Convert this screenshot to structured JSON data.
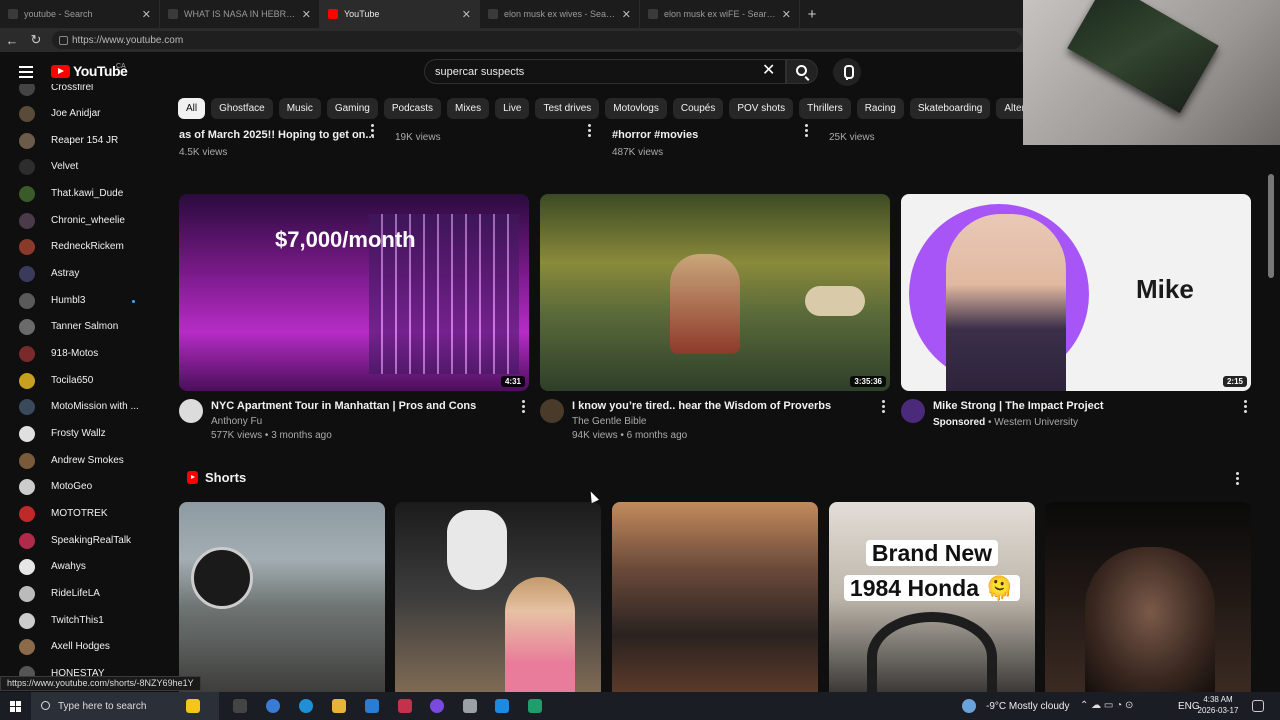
{
  "browser": {
    "tabs": [
      {
        "label": "youtube - Search",
        "active": false
      },
      {
        "label": "WHAT IS NASA IN HEBREW - Search",
        "active": false
      },
      {
        "label": "YouTube",
        "active": true
      },
      {
        "label": "elon musk ex wives - Search",
        "active": false
      },
      {
        "label": "elon musk ex wiFE - Search Images",
        "active": false
      }
    ],
    "new_tab": "+",
    "url": "https://www.youtube.com"
  },
  "youtube": {
    "logo_text": "YouTube",
    "country_code": "CA",
    "search_value": "supercar suspects"
  },
  "sidebar": {
    "partial_top": "Crossfirel",
    "subscriptions": [
      {
        "name": "Joe Anidjar",
        "color": "#5a4a3a"
      },
      {
        "name": "Reaper 154 JR",
        "color": "#6b5b4b"
      },
      {
        "name": "Velvet",
        "color": "#2d2d2d"
      },
      {
        "name": "That.kawi_Dude",
        "color": "#3a5a2a"
      },
      {
        "name": "Chronic_wheelie",
        "color": "#4a3a4a"
      },
      {
        "name": "RedneckRickem",
        "color": "#8a3a2a"
      },
      {
        "name": "Astray",
        "color": "#3a3a5a"
      },
      {
        "name": "Humbl3",
        "color": "#5a5a5a",
        "new": true
      },
      {
        "name": "Tanner Salmon",
        "color": "#6a6a6a"
      },
      {
        "name": "918-Motos",
        "color": "#7a2a2a"
      },
      {
        "name": "Tocila650",
        "color": "#c7a020"
      },
      {
        "name": "MotoMission with ...",
        "color": "#3a4a5a"
      },
      {
        "name": "Frosty Wallz",
        "color": "#e0e0e0"
      },
      {
        "name": "Andrew Smokes",
        "color": "#7a5a3a"
      },
      {
        "name": "MotoGeo",
        "color": "#cccccc"
      },
      {
        "name": "MOTOTREK",
        "color": "#c0282a"
      },
      {
        "name": "SpeakingRealTalk",
        "color": "#b02a4a"
      },
      {
        "name": "Awahys",
        "color": "#e6e6e6"
      },
      {
        "name": "RideLifeLA",
        "color": "#bbbbbb"
      },
      {
        "name": "TwitchThis1",
        "color": "#cccccc"
      },
      {
        "name": "Axell Hodges",
        "color": "#8a6a4a"
      }
    ],
    "partial_bottom": "HONESTAY"
  },
  "chips": [
    "All",
    "Ghostface",
    "Music",
    "Gaming",
    "Podcasts",
    "Mixes",
    "Live",
    "Test drives",
    "Motovlogs",
    "Coupés",
    "POV shots",
    "Thrillers",
    "Racing",
    "Skateboarding",
    "Alter"
  ],
  "above_row": {
    "v1_title": "as of March 2025!! Hoping to get on...",
    "v1_views": "4.5K views",
    "v2_views": "19K views",
    "v3_title": "#horror #movies",
    "v3_views": "487K views",
    "v4_views": "25K views"
  },
  "videos": [
    {
      "title": "NYC Apartment Tour in Manhattan | Pros and Cons",
      "channel": "Anthony Fu",
      "meta": "577K views • 3 months ago",
      "duration": "4:31",
      "overlay": "$7,000/month"
    },
    {
      "title": "I know you’re tired.. hear the Wisdom of Proverbs",
      "channel": "The Gentle Bible",
      "meta": "94K views • 6 months ago",
      "duration": "3:35:36"
    },
    {
      "title": "Mike Strong | The Impact Project",
      "sponsored": "Sponsored",
      "channel": "• Western University",
      "duration": "2:15",
      "overlay": "Mike"
    }
  ],
  "shorts": {
    "heading": "Shorts",
    "s4_line1": "Brand New",
    "s4_line2": "1984 Honda 🫠"
  },
  "status_link": "https://www.youtube.com/shorts/-8NZY69he1Y",
  "taskbar": {
    "search_placeholder": "Type here to search",
    "weather": "-9°C  Mostly cloudy",
    "lang": "ENG",
    "time": "4:38 AM",
    "date": "2026-03-17"
  }
}
